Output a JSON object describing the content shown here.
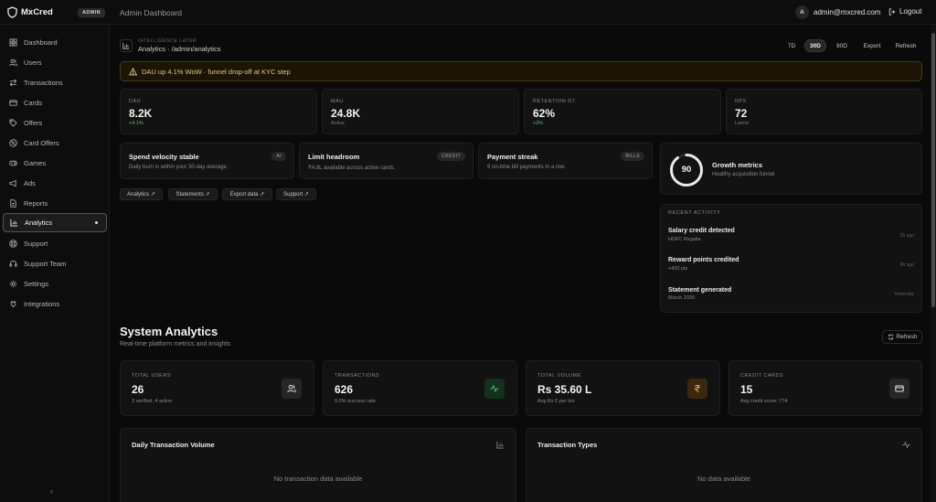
{
  "topbar": {
    "brand": "MxCred",
    "badge": "ADMIN",
    "title": "Admin Dashboard",
    "avatar_initial": "A",
    "user_email": "admin@mxcred.com",
    "logout_label": "Logout"
  },
  "sidebar": {
    "items": [
      {
        "label": "Dashboard",
        "icon": "grid-icon"
      },
      {
        "label": "Users",
        "icon": "users-icon"
      },
      {
        "label": "Transactions",
        "icon": "arrows-icon"
      },
      {
        "label": "Cards",
        "icon": "card-icon"
      },
      {
        "label": "Offers",
        "icon": "tag-icon"
      },
      {
        "label": "Card Offers",
        "icon": "percent-icon"
      },
      {
        "label": "Games",
        "icon": "gamepad-icon"
      },
      {
        "label": "Ads",
        "icon": "megaphone-icon"
      },
      {
        "label": "Reports",
        "icon": "file-icon"
      },
      {
        "label": "Analytics",
        "icon": "chart-icon",
        "active": true
      },
      {
        "label": "Support",
        "icon": "lifebuoy-icon"
      },
      {
        "label": "Support Team",
        "icon": "headset-icon"
      },
      {
        "label": "Settings",
        "icon": "gear-icon"
      },
      {
        "label": "Integrations",
        "icon": "plug-icon"
      }
    ],
    "collapse_glyph": "‹"
  },
  "intel": {
    "layer_label": "INTELLIGENCE LAYER",
    "breadcrumb": "Analytics · /admin/analytics",
    "ranges": [
      "7D",
      "30D",
      "90D",
      "Export",
      "Refresh"
    ],
    "active_range": "30D",
    "alert": "DAU up 4.1% WoW · funnel drop-off at KYC step"
  },
  "kpis": [
    {
      "label": "DAU",
      "value": "8.2K",
      "sub": "+4.1%",
      "positive": true
    },
    {
      "label": "MAU",
      "value": "24.8K",
      "sub": "Active",
      "positive": false
    },
    {
      "label": "RETENTION D7",
      "value": "62%",
      "sub": "+2%",
      "positive": true
    },
    {
      "label": "NPS",
      "value": "72",
      "sub": "Latest",
      "positive": false
    }
  ],
  "insights": [
    {
      "title": "Spend velocity stable",
      "desc": "Daily burn is within your 30-day average.",
      "tag": "AI"
    },
    {
      "title": "Limit headroom",
      "desc": "₹4.8L available across active cards.",
      "tag": "CREDIT"
    },
    {
      "title": "Payment streak",
      "desc": "9 on-time bill payments in a row.",
      "tag": "BILLS"
    }
  ],
  "chips": [
    "Analytics ↗",
    "Statements ↗",
    "Export data ↗",
    "Support ↗"
  ],
  "growth": {
    "score": "90",
    "score_value": 90,
    "title": "Growth metrics",
    "sub": "Healthy acquisition funnel"
  },
  "recent_activity": {
    "header": "RECENT ACTIVITY",
    "items": [
      {
        "title": "Salary credit detected",
        "sub": "HDFC Regalia",
        "time": "2h ago"
      },
      {
        "title": "Reward points credited",
        "sub": "+420 pts",
        "time": "5h ago"
      },
      {
        "title": "Statement generated",
        "sub": "March 2026",
        "time": "Yesterday"
      }
    ]
  },
  "system": {
    "title": "System Analytics",
    "subtitle": "Real-time platform metrics and insights",
    "refresh_label": "Refresh",
    "stats": [
      {
        "label": "TOTAL USERS",
        "value": "26",
        "sub": "3 verified, 4 active",
        "icon": "users-icon",
        "color": "#262626"
      },
      {
        "label": "TRANSACTIONS",
        "value": "626",
        "sub": "0.0% success rate",
        "icon": "activity-icon",
        "color": "#15301c"
      },
      {
        "label": "TOTAL VOLUME",
        "value": "Rs 35.60 L",
        "sub": "Avg Rs 0 per txn",
        "icon": "rupee-icon",
        "color": "#3a2710"
      },
      {
        "label": "CREDIT CARDS",
        "value": "15",
        "sub": "Avg credit score: 774",
        "icon": "card-icon",
        "color": "#262626"
      }
    ],
    "panels": [
      {
        "title": "Daily Transaction Volume",
        "empty": "No transaction data available",
        "icon": "bar-chart-icon"
      },
      {
        "title": "Transaction Types",
        "empty": "No data available",
        "icon": "activity-icon"
      }
    ]
  },
  "colors": {
    "accent_positive": "#4fc26b",
    "alert_bg": "#1c1506",
    "alert_text": "#e4c77a"
  }
}
